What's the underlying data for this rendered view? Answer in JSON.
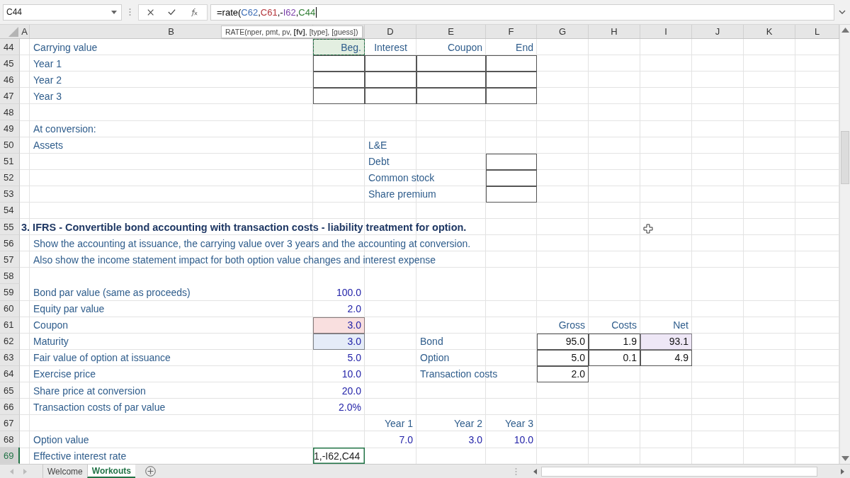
{
  "name_box": "C44",
  "formula": [
    {
      "text": "=rate("
    },
    {
      "text": "C62",
      "color": "#3b6cb5"
    },
    {
      "text": ","
    },
    {
      "text": "C61",
      "color": "#b3343a"
    },
    {
      "text": ",-"
    },
    {
      "text": "I62",
      "color": "#7a3fa8"
    },
    {
      "text": ","
    },
    {
      "text": "C44",
      "color": "#2e7d32"
    }
  ],
  "function_tooltip": "RATE(nper, pmt, pv, **[fv]**, [type], [guess])",
  "column_headers": {
    "A": "A",
    "B": "B",
    "D": "D",
    "E": "E",
    "F": "F",
    "G": "G",
    "H": "H",
    "I": "I",
    "J": "J",
    "K": "K",
    "L": "L"
  },
  "rows": [
    {
      "number": "44",
      "selected": false,
      "B": {
        "kind": "label",
        "text": "Carrying value"
      },
      "C": {
        "kind": "reference",
        "text": "Beg.",
        "color": "#e3efe1"
      },
      "D": {
        "kind": "label-center",
        "text": "Interest"
      },
      "E": {
        "kind": "label-right",
        "text": "Coupon"
      },
      "F": {
        "kind": "label-right",
        "text": "End"
      }
    },
    {
      "number": "45",
      "selected": false,
      "B": {
        "kind": "label",
        "text": "Year 1"
      },
      "C": {
        "kind": "box"
      },
      "D": {
        "kind": "box"
      },
      "E": {
        "kind": "box"
      },
      "F": {
        "kind": "box"
      }
    },
    {
      "number": "46",
      "selected": false,
      "B": {
        "kind": "label",
        "text": "Year 2"
      },
      "C": {
        "kind": "box"
      },
      "D": {
        "kind": "box"
      },
      "E": {
        "kind": "box"
      },
      "F": {
        "kind": "box"
      }
    },
    {
      "number": "47",
      "selected": false,
      "B": {
        "kind": "label",
        "text": "Year 3"
      },
      "C": {
        "kind": "box"
      },
      "D": {
        "kind": "box"
      },
      "E": {
        "kind": "box"
      },
      "F": {
        "kind": "box"
      }
    },
    {
      "number": "48",
      "selected": false
    },
    {
      "number": "49",
      "selected": false,
      "B": {
        "kind": "label",
        "text": "At conversion:"
      }
    },
    {
      "number": "50",
      "selected": false,
      "B": {
        "kind": "label",
        "text": "Assets"
      },
      "D": {
        "kind": "label",
        "text": "L&E"
      }
    },
    {
      "number": "51",
      "selected": false,
      "D": {
        "kind": "label",
        "text": "Debt"
      },
      "F": {
        "kind": "box"
      }
    },
    {
      "number": "52",
      "selected": false,
      "D": {
        "kind": "label",
        "text": "Common stock"
      },
      "F": {
        "kind": "box"
      }
    },
    {
      "number": "53",
      "selected": false,
      "D": {
        "kind": "label",
        "text": "Share premium"
      },
      "F": {
        "kind": "box"
      }
    },
    {
      "number": "54",
      "selected": false
    },
    {
      "number": "55",
      "selected": false,
      "A": {
        "kind": "title",
        "text": "3. IFRS - Convertible bond accounting with transaction costs - liability treatment for option."
      }
    },
    {
      "number": "56",
      "selected": false,
      "B": {
        "kind": "label",
        "text": "Show the accounting at issuance, the carrying value over 3 years and the accounting at conversion."
      }
    },
    {
      "number": "57",
      "selected": false,
      "B": {
        "kind": "label",
        "text": "Also show the income statement impact for both option value changes and interest expense"
      }
    },
    {
      "number": "58",
      "selected": false
    },
    {
      "number": "59",
      "selected": false,
      "B": {
        "kind": "label",
        "text": "Bond par value (same as proceeds)"
      },
      "C": {
        "kind": "input",
        "text": "100.0"
      }
    },
    {
      "number": "60",
      "selected": false,
      "B": {
        "kind": "label",
        "text": "Equity par value"
      },
      "C": {
        "kind": "input",
        "text": "2.0"
      }
    },
    {
      "number": "61",
      "selected": false,
      "B": {
        "kind": "label",
        "text": "Coupon"
      },
      "C": {
        "kind": "input",
        "text": "3.0",
        "color": "#f9dfdf"
      },
      "G": {
        "kind": "label-right",
        "text": "Gross"
      },
      "H": {
        "kind": "label-right",
        "text": "Costs"
      },
      "I": {
        "kind": "label-right",
        "text": "Net"
      }
    },
    {
      "number": "62",
      "selected": false,
      "B": {
        "kind": "label",
        "text": "Maturity"
      },
      "C": {
        "kind": "input",
        "text": "3.0",
        "color": "#e5ecf8"
      },
      "E": {
        "kind": "label",
        "text": "Bond"
      },
      "G": {
        "kind": "value",
        "text": "95.0"
      },
      "H": {
        "kind": "value",
        "text": "1.9"
      },
      "I": {
        "kind": "value",
        "text": "93.1",
        "color": "#eee7f6"
      }
    },
    {
      "number": "63",
      "selected": false,
      "B": {
        "kind": "label",
        "text": "Fair value of option at issuance"
      },
      "C": {
        "kind": "input",
        "text": "5.0"
      },
      "E": {
        "kind": "label",
        "text": "Option"
      },
      "G": {
        "kind": "value",
        "text": "5.0"
      },
      "H": {
        "kind": "value",
        "text": "0.1"
      },
      "I": {
        "kind": "value",
        "text": "4.9"
      }
    },
    {
      "number": "64",
      "selected": false,
      "B": {
        "kind": "label",
        "text": "Exercise price"
      },
      "C": {
        "kind": "input",
        "text": "10.0"
      },
      "E": {
        "kind": "label",
        "text": "Transaction costs"
      },
      "G": {
        "kind": "value",
        "text": "2.0"
      }
    },
    {
      "number": "65",
      "selected": false,
      "B": {
        "kind": "label",
        "text": "Share price at conversion"
      },
      "C": {
        "kind": "input",
        "text": "20.0"
      }
    },
    {
      "number": "66",
      "selected": false,
      "B": {
        "kind": "label",
        "text": "Transaction costs of par value"
      },
      "C": {
        "kind": "input",
        "text": "2.0%"
      }
    },
    {
      "number": "67",
      "selected": false,
      "D": {
        "kind": "label-right",
        "text": "Year 1"
      },
      "E": {
        "kind": "label-right",
        "text": "Year 2"
      },
      "F": {
        "kind": "label-right",
        "text": "Year 3"
      }
    },
    {
      "number": "68",
      "selected": false,
      "B": {
        "kind": "label",
        "text": "Option value"
      },
      "D": {
        "kind": "input",
        "text": "7.0"
      },
      "E": {
        "kind": "input",
        "text": "3.0"
      },
      "F": {
        "kind": "input",
        "text": "10.0"
      }
    },
    {
      "number": "69",
      "selected": true,
      "B": {
        "kind": "label",
        "text": "Effective interest rate"
      },
      "C": {
        "kind": "editing",
        "text": "1,-I62,C44"
      }
    }
  ],
  "sheet_tabs": [
    {
      "label": "Welcome",
      "selected": false
    },
    {
      "label": "Workouts",
      "selected": true
    }
  ]
}
